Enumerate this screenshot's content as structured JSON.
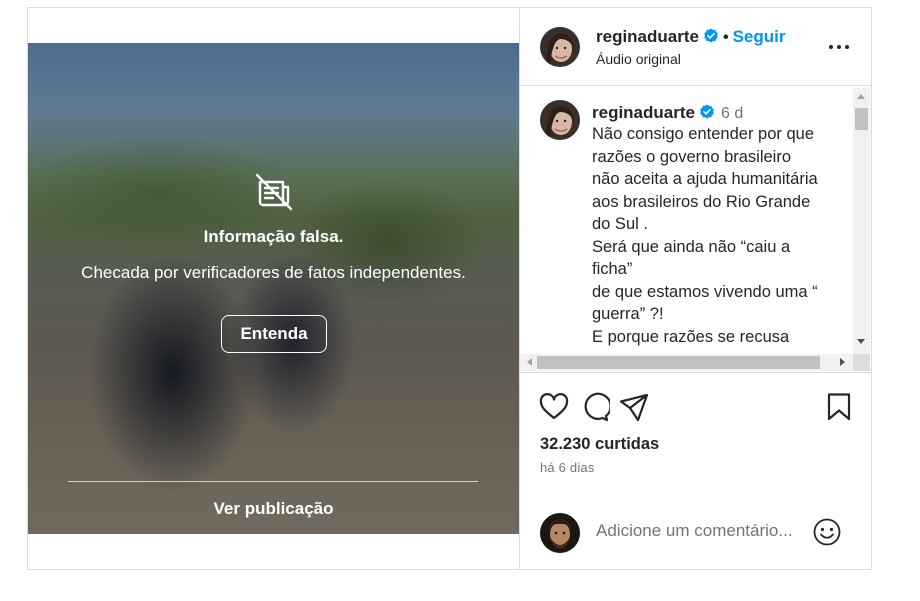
{
  "media": {
    "warning_title": "Informação falsa.",
    "warning_subtitle": "Checada por verificadores de fatos independentes.",
    "learn_button": "Entenda",
    "view_post": "Ver publicação",
    "warning_icon": "news-crossed-icon"
  },
  "header": {
    "username": "reginaduarte",
    "separator": "•",
    "follow_label": "Seguir",
    "audio_label": "Áudio original",
    "more_icon": "more-options-icon"
  },
  "caption": {
    "username": "reginaduarte",
    "time": "6 d",
    "text": "Não consigo entender por que\nrazões o governo brasileiro\nnão aceita a ajuda humanitária\naos brasileiros do Rio Grande\ndo Sul .\nSerá que ainda não “caiu a\nficha”\nde que estamos vivendo uma “\nguerra” ?!\nE porque razões se recusa"
  },
  "actions": {
    "icons": [
      "heart-icon",
      "comment-icon",
      "share-icon",
      "bookmark-icon"
    ]
  },
  "stats": {
    "likes": "32.230 curtidas",
    "posted_ago": "há 6 dias"
  },
  "comment_box": {
    "placeholder": "Adicione um comentário...",
    "emoji_icon": "emoji-icon"
  },
  "colors": {
    "accent": "#0095f6",
    "verified": "#0095f6",
    "border": "#dbdbdb",
    "muted_text": "#737373"
  }
}
